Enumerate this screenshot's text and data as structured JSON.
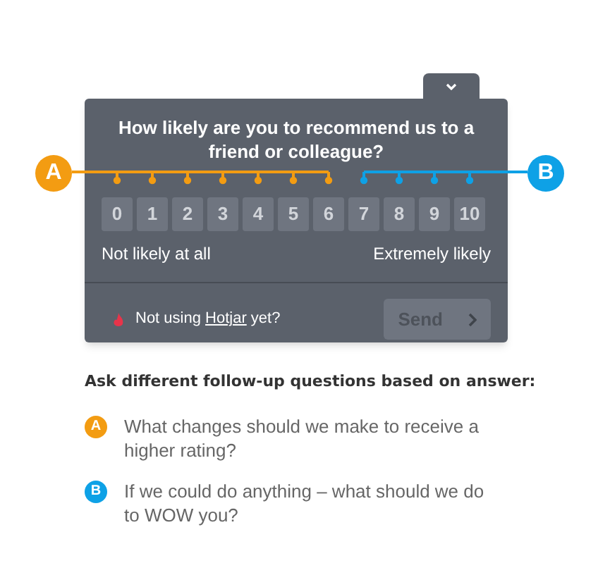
{
  "survey": {
    "question": "How likely are you to recommend us to a friend or colleague?",
    "low_label": "Not likely at all",
    "high_label": "Extremely likely",
    "footer_before": "Not using ",
    "footer_link": "Hotjar",
    "footer_after": " yet?",
    "send_button": {
      "label": "Send",
      "disabled": true
    }
  },
  "groups": [
    {
      "badge": "A",
      "color": "#f39c12",
      "scores": [
        "0",
        "1",
        "2",
        "3",
        "4",
        "5",
        "6"
      ]
    },
    {
      "badge": "B",
      "color": "#0ea1e6",
      "scores": [
        "7",
        "8",
        "9",
        "10"
      ]
    }
  ],
  "heading": "Ask different follow-up questions based on answer:",
  "follow_ups": [
    {
      "badge": "A",
      "color": "#f39c12",
      "text": "What changes should we make to receive a higher rating?"
    },
    {
      "badge": "B",
      "color": "#0ea1e6",
      "text": "If we could do anything – what should we do to WOW you?"
    }
  ]
}
